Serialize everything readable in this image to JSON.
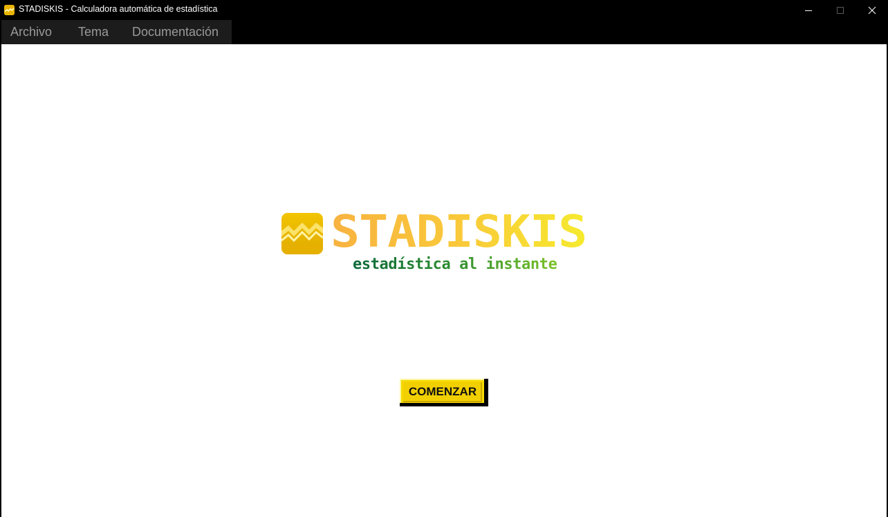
{
  "window": {
    "title": "STADISKIS - Calculadora automática de estadística",
    "icon": "stadiskis-app-icon",
    "controls": [
      "minimize-icon",
      "maximize-icon",
      "close-icon"
    ]
  },
  "menu": {
    "items": [
      {
        "label": "Archivo"
      },
      {
        "label": "Tema"
      },
      {
        "label": "Documentación"
      }
    ]
  },
  "logo": {
    "wordmark": "STADISKIS",
    "tagline": "estadística al instante",
    "icon": "stadiskis-logo-icon",
    "colors": {
      "wordmark_start": "#f8b240",
      "wordmark_end": "#f6ea2e",
      "tagline_start": "#0d6a3a",
      "tagline_end": "#7cc22a"
    }
  },
  "start_button": {
    "label": "COMENZAR",
    "color": "#f5d800"
  }
}
